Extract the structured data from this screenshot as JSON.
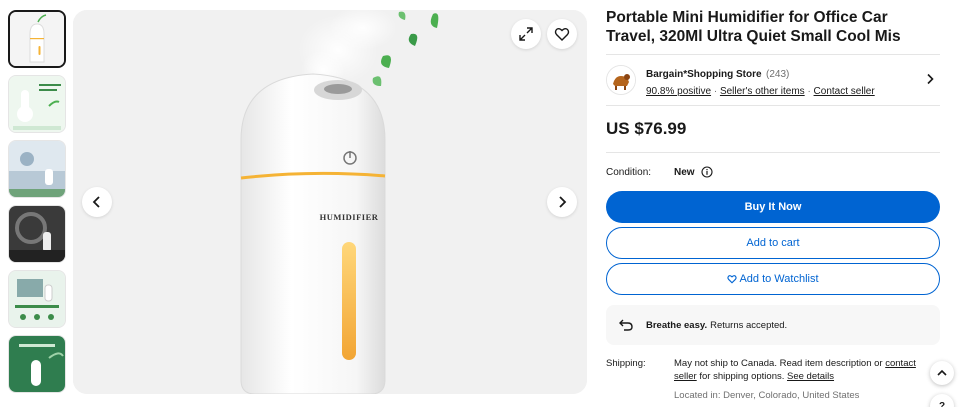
{
  "listing": {
    "title": "Portable Mini Humidifier for Office Car Travel, 320Ml Ultra Quiet Small Cool Mis",
    "product_label": "HUMIDIFIER"
  },
  "thumbnails": [
    {
      "name": "thumb-humidifier-white",
      "selected": true
    },
    {
      "name": "thumb-features-infographic",
      "selected": false
    },
    {
      "name": "thumb-bedroom-scene",
      "selected": false
    },
    {
      "name": "thumb-car-scene",
      "selected": false
    },
    {
      "name": "thumb-office-scene",
      "selected": false
    },
    {
      "name": "thumb-green-promo",
      "selected": false
    }
  ],
  "seller": {
    "name": "Bargain*Shopping Store",
    "count": "(243)",
    "positive": "90.8% positive",
    "other_items": "Seller's other items",
    "contact": "Contact seller"
  },
  "price": "US $76.99",
  "condition": {
    "label": "Condition:",
    "value": "New"
  },
  "buttons": {
    "buy": "Buy It Now",
    "cart": "Add to cart",
    "watch": "Add to Watchlist"
  },
  "returns": {
    "bold": "Breathe easy.",
    "text": "Returns accepted."
  },
  "shipping": {
    "label": "Shipping:",
    "text1": "May not ship to Canada. Read item description or ",
    "contact_link": "contact seller",
    "text2": " for shipping options. ",
    "details_link": "See details",
    "location": "Located in: Denver, Colorado, United States"
  },
  "floating": {
    "help": "?"
  },
  "colors": {
    "accent": "#0064d2",
    "glow": "#f5b335",
    "leaf": "#4caf50"
  }
}
